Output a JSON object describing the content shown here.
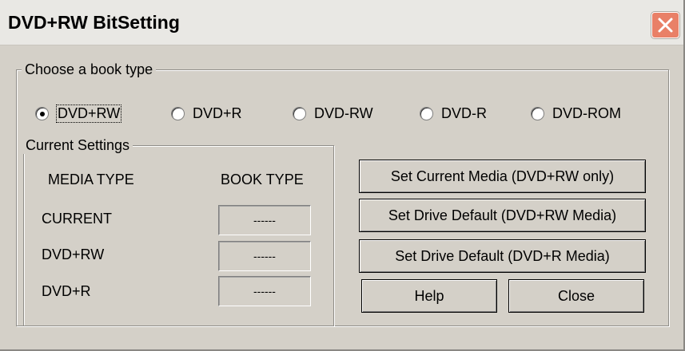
{
  "window": {
    "title": "DVD+RW BitSetting"
  },
  "book_type": {
    "label": "Choose a book type",
    "options": [
      "DVD+RW",
      "DVD+R",
      "DVD-RW",
      "DVD-R",
      "DVD-ROM"
    ],
    "selected": "DVD+RW"
  },
  "current_settings": {
    "label": "Current Settings",
    "media_type_header": "MEDIA TYPE",
    "book_type_header": "BOOK TYPE",
    "rows": [
      {
        "label": "CURRENT",
        "value": "------"
      },
      {
        "label": "DVD+RW",
        "value": "------"
      },
      {
        "label": "DVD+R",
        "value": "------"
      }
    ]
  },
  "buttons": {
    "set_current_media": "Set Current Media (DVD+RW only)",
    "set_default_rw": "Set Drive Default (DVD+RW Media)",
    "set_default_r": "Set Drive Default (DVD+R Media)",
    "help": "Help",
    "close": "Close"
  },
  "colors": {
    "close_button": "#e98067",
    "dialog_face": "#d4d0c8"
  },
  "icons": {
    "close": "close-icon"
  }
}
